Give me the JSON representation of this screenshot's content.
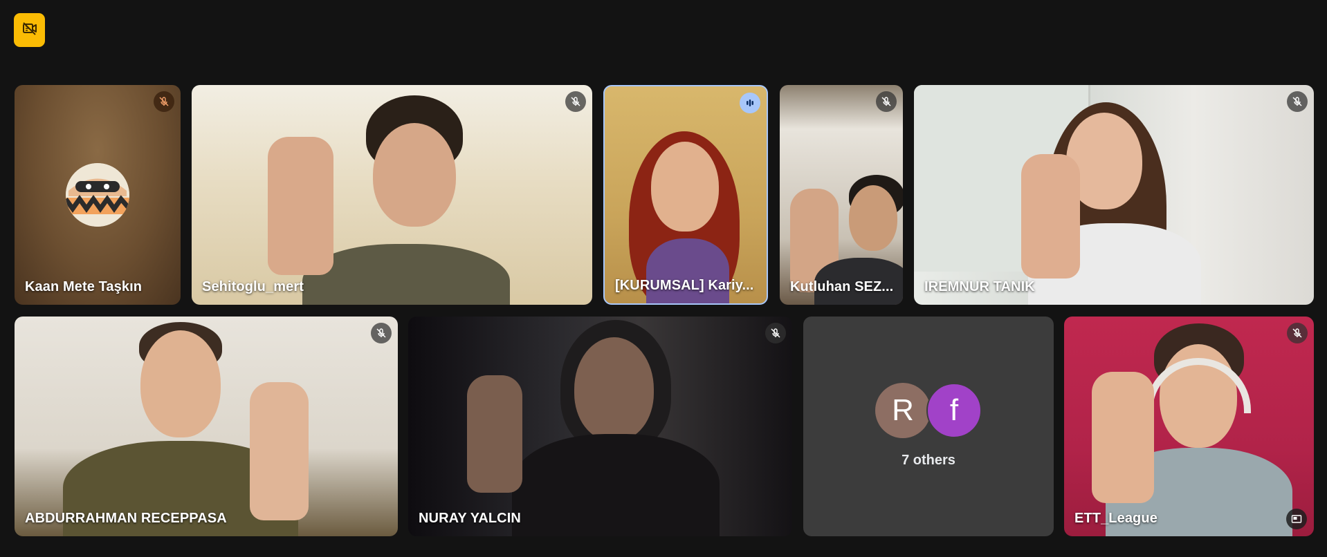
{
  "toolbar": {
    "camera_off_icon": "video-off-icon",
    "accent": "#fbbc04"
  },
  "participants": [
    {
      "name": "Kaan Mete Taşkın",
      "muted": true
    },
    {
      "name": "Sehitoglu_mert",
      "muted": true
    },
    {
      "name": "[KURUMSAL] Kariy...",
      "speaking": true
    },
    {
      "name": "Kutluhan SEZ...",
      "muted": true
    },
    {
      "name": "IREMNUR TANIK",
      "muted": true
    },
    {
      "name": "ABDURRAHMAN RECEPPASA",
      "muted": true
    },
    {
      "name": "NURAY YALCIN",
      "muted": true
    },
    {
      "name": "ETT_League",
      "muted": true
    }
  ],
  "others": {
    "initials": [
      "R",
      "f"
    ],
    "label": "7 others"
  }
}
